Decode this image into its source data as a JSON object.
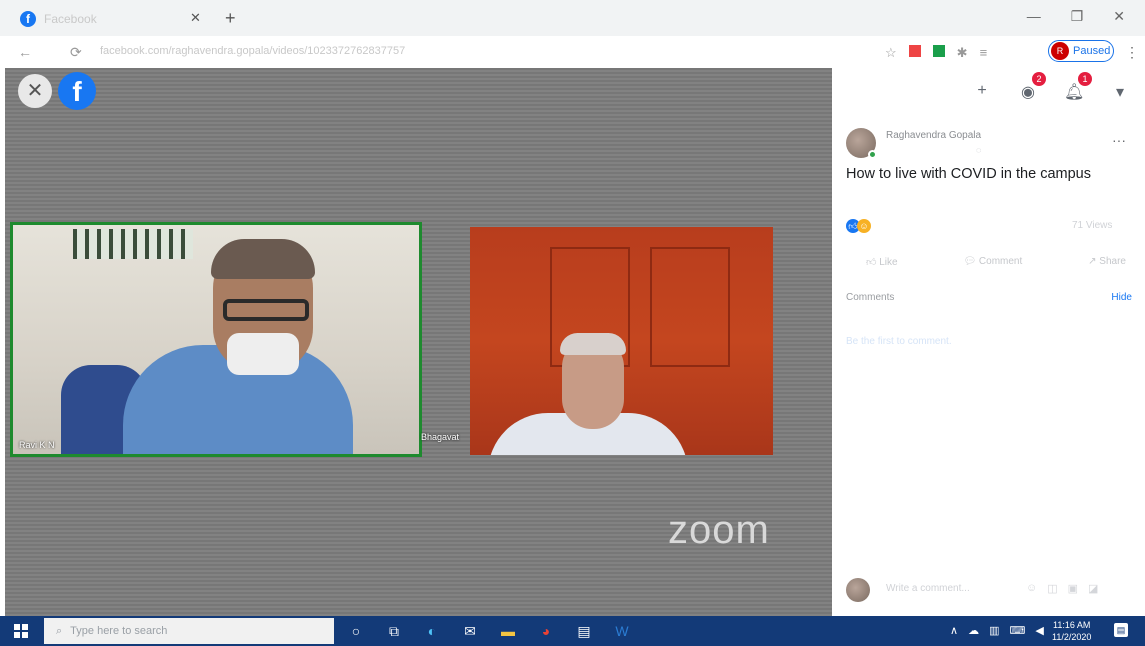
{
  "browser": {
    "tab_title": "Facebook",
    "url": "facebook.com/raghavendra.gopala/videos/1023372762837757",
    "profile_button": "Paused",
    "profile_initial": "R"
  },
  "video": {
    "participants": [
      {
        "name": "Ravi K N"
      },
      {
        "name": "Bhagavat"
      }
    ],
    "watermark": "zoom"
  },
  "post": {
    "author": "Raghavendra Gopala",
    "title": "How to live with COVID in the campus",
    "views": "71 Views",
    "actions": [
      "Like",
      "Comment",
      "Share"
    ],
    "comments_label": "Comments",
    "hide_label": "Hide",
    "empty_comments_text": "Be the first to comment.",
    "comment_placeholder": "Write a comment...",
    "badges": {
      "messenger": "2",
      "notifications": "1"
    }
  },
  "taskbar": {
    "search_placeholder": "Type here to search",
    "time": "11:16 AM",
    "date": "11/2/2020"
  }
}
